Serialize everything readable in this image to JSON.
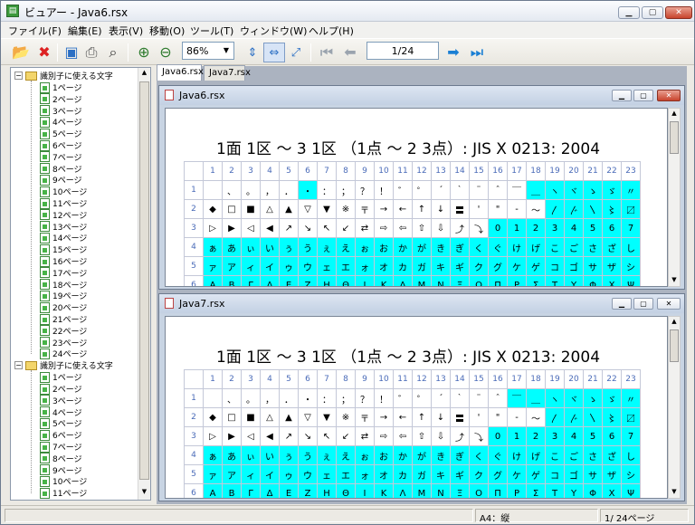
{
  "window": {
    "title": "ビュアー - Java6.rsx",
    "app_icon": "viewer-app-icon"
  },
  "menu": [
    {
      "label": "ファイル(F)"
    },
    {
      "label": "編集(E)"
    },
    {
      "label": "表示(V)"
    },
    {
      "label": "移動(O)"
    },
    {
      "label": "ツール(T)"
    },
    {
      "label": "ウィンドウ(W)"
    },
    {
      "label": "ヘルプ(H)"
    }
  ],
  "toolbar": {
    "zoom_value": "86%",
    "page_value": "1/24"
  },
  "tree": {
    "groups": [
      {
        "label": "識別子に使える文字",
        "pages": [
          "1ページ",
          "2ページ",
          "3ページ",
          "4ページ",
          "5ページ",
          "6ページ",
          "7ページ",
          "8ページ",
          "9ページ",
          "10ページ",
          "11ページ",
          "12ページ",
          "13ページ",
          "14ページ",
          "15ページ",
          "16ページ",
          "17ページ",
          "18ページ",
          "19ページ",
          "20ページ",
          "21ページ",
          "22ページ",
          "23ページ",
          "24ページ"
        ]
      },
      {
        "label": "識別子に使える文字",
        "pages": [
          "1ページ",
          "2ページ",
          "3ページ",
          "4ページ",
          "5ページ",
          "6ページ",
          "7ページ",
          "8ページ",
          "9ページ",
          "10ページ",
          "11ページ"
        ]
      }
    ]
  },
  "tabs": [
    {
      "label": "Java6.rsx"
    },
    {
      "label": "Java7.rsx"
    }
  ],
  "documents": [
    {
      "title": "Java6.rsx",
      "sheet_title": "1面 1区 ～ 3 1区 （1点 ～ 2 3点）: JIS X 0213: 2004"
    },
    {
      "title": "Java7.rsx",
      "sheet_title": "1面 1区 ～ 3 1区 （1点 ～ 2 3点）: JIS X 0213: 2004"
    }
  ],
  "grid": {
    "col_headers": [
      "1",
      "2",
      "3",
      "4",
      "5",
      "6",
      "7",
      "8",
      "9",
      "10",
      "11",
      "12",
      "13",
      "14",
      "15",
      "16",
      "17",
      "18",
      "19",
      "20",
      "21",
      "22",
      "23"
    ],
    "rows": [
      {
        "header": "1",
        "cells": [
          "",
          "、",
          "。",
          "，",
          "．",
          "・",
          "：",
          "；",
          "？",
          "！",
          "゛",
          "゜",
          "´",
          "｀",
          "¨",
          "＾",
          "￣",
          "＿",
          "ヽ",
          "ヾ",
          "ゝ",
          "ゞ",
          "〃"
        ]
      },
      {
        "header": "2",
        "cells": [
          "◆",
          "□",
          "■",
          "△",
          "▲",
          "▽",
          "▼",
          "※",
          "〒",
          "→",
          "←",
          "↑",
          "↓",
          "〓",
          "'",
          "\"",
          "-",
          "～",
          "〳",
          "〴",
          "〵",
          "〻",
          "〼"
        ]
      },
      {
        "header": "3",
        "cells": [
          "▷",
          "▶",
          "◁",
          "◀",
          "↗",
          "↘",
          "↖",
          "↙",
          "⇄",
          "⇨",
          "⇦",
          "⇧",
          "⇩",
          "⤴",
          "⤵",
          "0",
          "1",
          "2",
          "3",
          "4",
          "5",
          "6",
          "7"
        ]
      },
      {
        "header": "4",
        "cells": [
          "ぁ",
          "あ",
          "ぃ",
          "い",
          "ぅ",
          "う",
          "ぇ",
          "え",
          "ぉ",
          "お",
          "か",
          "が",
          "き",
          "ぎ",
          "く",
          "ぐ",
          "け",
          "げ",
          "こ",
          "ご",
          "さ",
          "ざ",
          "し"
        ]
      },
      {
        "header": "5",
        "cells": [
          "ァ",
          "ア",
          "ィ",
          "イ",
          "ゥ",
          "ウ",
          "ェ",
          "エ",
          "ォ",
          "オ",
          "カ",
          "ガ",
          "キ",
          "ギ",
          "ク",
          "グ",
          "ケ",
          "ゲ",
          "コ",
          "ゴ",
          "サ",
          "ザ",
          "シ"
        ]
      },
      {
        "header": "6",
        "cells": [
          "Α",
          "Β",
          "Γ",
          "Δ",
          "Ε",
          "Ζ",
          "Η",
          "Θ",
          "Ι",
          "Κ",
          "Λ",
          "Μ",
          "Ν",
          "Ξ",
          "Ο",
          "Π",
          "Ρ",
          "Σ",
          "Τ",
          "Υ",
          "Φ",
          "Χ",
          "Ψ"
        ]
      }
    ],
    "highlight_color": "#00ffff",
    "doc1_highlight": {
      "1": [
        5
      ],
      "2": [],
      "3": [],
      "4": "all",
      "5": "all",
      "6": "all"
    },
    "doc2_highlight": {
      "1": [
        16
      ],
      "2": [],
      "3": [],
      "4": "all",
      "5": "all",
      "6": "all"
    }
  },
  "status": {
    "paper": "A4：縦",
    "pages": "1/ 24ページ"
  }
}
